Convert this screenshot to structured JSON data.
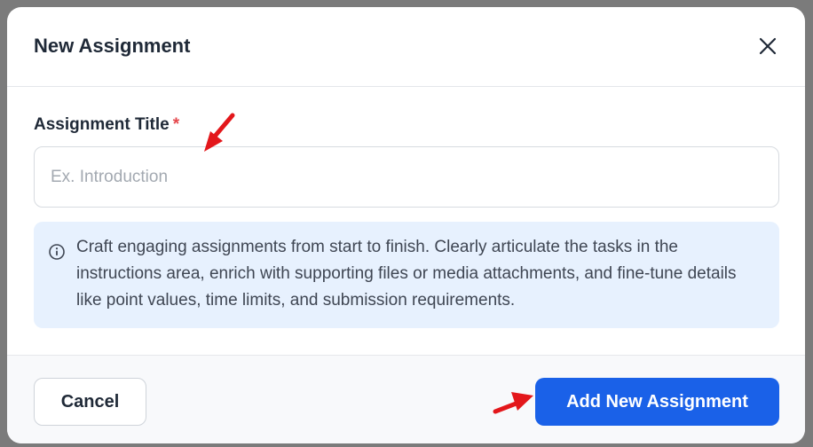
{
  "modal": {
    "title": "New Assignment"
  },
  "form": {
    "title_label": "Assignment Title",
    "required_marker": "*",
    "title_value": "",
    "title_placeholder": "Ex. Introduction"
  },
  "info": {
    "text": "Craft engaging assignments from start to finish. Clearly articulate the tasks in the instructions area, enrich with supporting files or media attachments, and fine-tune details like point values, time limits, and submission requirements."
  },
  "footer": {
    "cancel_label": "Cancel",
    "submit_label": "Add New Assignment"
  },
  "icons": {
    "close": "close-icon",
    "info": "info-icon",
    "annotation": "red-arrow-icon"
  },
  "colors": {
    "primary": "#1a61e8",
    "required": "#e5484d",
    "info_bg": "#e7f1fe",
    "annotation": "#e3171b"
  }
}
